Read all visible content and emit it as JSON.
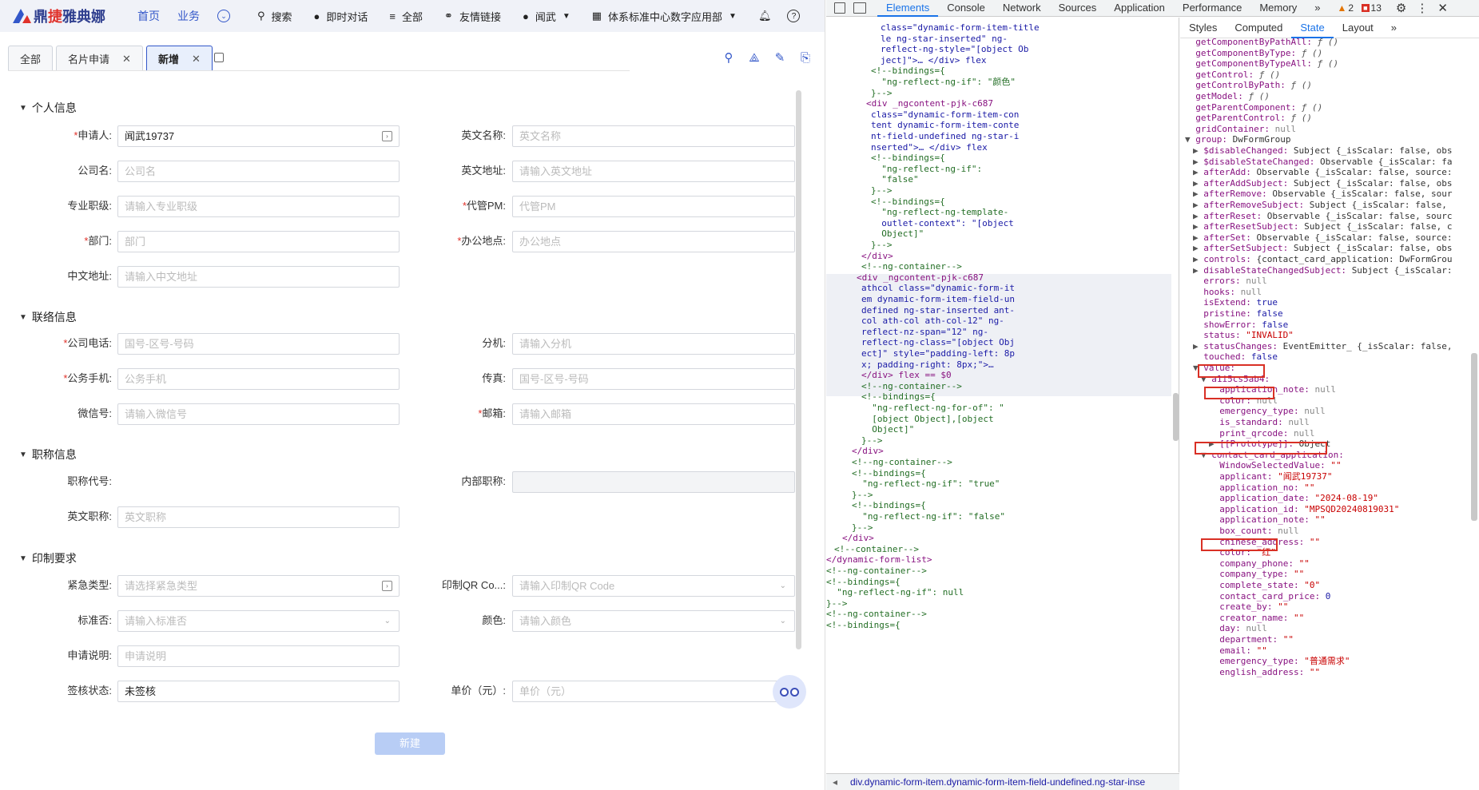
{
  "app": {
    "logo_text_a": "鼎",
    "logo_text_b": "捷",
    "logo_text_c": "雅典娜",
    "nav": [
      "首页",
      "业务"
    ],
    "top_items": [
      {
        "icon": "search-icon",
        "label": "搜索"
      },
      {
        "icon": "chat-icon",
        "label": "即时对话"
      },
      {
        "icon": "menu-icon",
        "label": "全部"
      },
      {
        "icon": "link-icon",
        "label": "友情链接"
      },
      {
        "icon": "user-icon",
        "label": "闻武"
      },
      {
        "icon": "building-icon",
        "label": "体系标准中心数字应用部"
      }
    ]
  },
  "tabs": [
    {
      "label": "全部",
      "closable": false,
      "active": false
    },
    {
      "label": "名片申请",
      "closable": true,
      "active": false
    },
    {
      "label": "新增",
      "closable": true,
      "active": true
    }
  ],
  "sections": {
    "personal": "个人信息",
    "contact": "联络信息",
    "title": "职称信息",
    "print": "印制要求"
  },
  "fields": {
    "applicant": {
      "label": "申请人:",
      "required": true,
      "value": "闻武19737",
      "placeholder": ""
    },
    "english_name": {
      "label": "英文名称:",
      "required": false,
      "value": "",
      "placeholder": "英文名称"
    },
    "company_name": {
      "label": "公司名:",
      "required": false,
      "value": "",
      "placeholder": "公司名"
    },
    "english_address": {
      "label": "英文地址:",
      "required": false,
      "value": "",
      "placeholder": "请输入英文地址"
    },
    "professional_rank": {
      "label": "专业职级:",
      "required": false,
      "value": "",
      "placeholder": "请输入专业职级"
    },
    "acting_pm": {
      "label": "代管PM:",
      "required": true,
      "value": "",
      "placeholder": "代管PM"
    },
    "department": {
      "label": "部门:",
      "required": true,
      "value": "",
      "placeholder": "部门"
    },
    "office_location": {
      "label": "办公地点:",
      "required": true,
      "value": "",
      "placeholder": "办公地点"
    },
    "chinese_address": {
      "label": "中文地址:",
      "required": false,
      "value": "",
      "placeholder": "请输入中文地址"
    },
    "company_phone": {
      "label": "公司电话:",
      "required": true,
      "value": "",
      "placeholder": "国号-区号-号码"
    },
    "extension": {
      "label": "分机:",
      "required": false,
      "value": "",
      "placeholder": "请输入分机"
    },
    "business_mobile": {
      "label": "公务手机:",
      "required": true,
      "value": "",
      "placeholder": "公务手机"
    },
    "fax": {
      "label": "传真:",
      "required": false,
      "value": "",
      "placeholder": "国号-区号-号码"
    },
    "wechat": {
      "label": "微信号:",
      "required": false,
      "value": "",
      "placeholder": "请输入微信号"
    },
    "email": {
      "label": "邮箱:",
      "required": true,
      "value": "",
      "placeholder": "请输入邮箱"
    },
    "title_code": {
      "label": "职称代号:",
      "required": false,
      "value": "",
      "placeholder": ""
    },
    "internal_title": {
      "label": "内部职称:",
      "required": false,
      "value": "",
      "placeholder": ""
    },
    "english_title": {
      "label": "英文职称:",
      "required": false,
      "value": "",
      "placeholder": "英文职称"
    },
    "emergency_type": {
      "label": "紧急类型:",
      "required": false,
      "value": "",
      "placeholder": "请选择紧急类型"
    },
    "print_qr": {
      "label": "印制QR Co...:",
      "required": false,
      "value": "",
      "placeholder": "请输入印制QR Code"
    },
    "is_standard": {
      "label": "标准否:",
      "required": false,
      "value": "",
      "placeholder": "请输入标准否"
    },
    "color": {
      "label": "颜色:",
      "required": false,
      "value": "",
      "placeholder": "请输入颜色"
    },
    "application_note": {
      "label": "申请说明:",
      "required": false,
      "value": "",
      "placeholder": "申请说明"
    },
    "review_status": {
      "label": "签核状态:",
      "required": false,
      "value": "未签核",
      "placeholder": ""
    },
    "unit_price": {
      "label": "单价（元）:",
      "required": false,
      "value": "",
      "placeholder": "单价（元）"
    }
  },
  "new_button": "新建",
  "devtools": {
    "tabs": [
      "Elements",
      "Console",
      "Network",
      "Sources",
      "Application",
      "Performance",
      "Memory",
      "»"
    ],
    "active_tab": "Elements",
    "warnings": "2",
    "errors": "13",
    "side_tabs": [
      "Styles",
      "Computed",
      "State",
      "Layout",
      "»"
    ],
    "active_side_tab": "State",
    "breadcrumb": "div.dynamic-form-item.dynamic-form-item-field-undefined.ng-star-inse",
    "element_lines": [
      "class=\"dynamic-form-item-title",
      "le ng-star-inserted\" ng-",
      "reflect-ng-style=\"[object Ob",
      "ject]\">… </div> flex",
      "<!--bindings={",
      "  \"ng-reflect-ng-if\": \"颜色\"",
      "}-->",
      "<div _ngcontent-pjk-c687",
      "class=\"dynamic-form-item-con",
      "tent dynamic-form-item-conte",
      "nt-field-undefined ng-star-i",
      "nserted\">… </div> flex",
      "<!--bindings={",
      "  \"ng-reflect-ng-if\":",
      "  \"false\"",
      "}-->",
      "<!--bindings={",
      "  \"ng-reflect-ng-template-",
      "  outlet-context\": \"[object",
      "  Object]\"",
      "}-->",
      "</div>",
      "<!--ng-container-->",
      "<div _ngcontent-pjk-c687",
      "athcol class=\"dynamic-form-it",
      "em dynamic-form-item-field-un",
      "defined ng-star-inserted ant-",
      "col ath-col ath-col-12\" ng-",
      "reflect-nz-span=\"12\" ng-",
      "reflect-ng-class=\"[object Obj",
      "ect]\" style=\"padding-left: 8p",
      "x; padding-right: 8px;\">…",
      "</div> flex == $0",
      "<!--ng-container-->",
      "<!--bindings={",
      "  \"ng-reflect-ng-for-of\": \"",
      "  [object Object],[object",
      "  Object]\"",
      "}-->",
      "</div>",
      "<!--ng-container-->",
      "<!--bindings={",
      "  \"ng-reflect-ng-if\": \"true\"",
      "}-->",
      "<!--bindings={",
      "  \"ng-reflect-ng-if\": \"false\"",
      "}-->",
      "</div>",
      "<!--container-->",
      "</dynamic-form-list>",
      "<!--ng-container-->",
      "<!--bindings={",
      "  \"ng-reflect-ng-if\": null",
      "}-->",
      "<!--ng-container-->",
      "<!--bindings={"
    ],
    "state_lines": [
      "getComponentByPathAll: ƒ ()",
      "getComponentByType: ƒ ()",
      "getComponentByTypeAll: ƒ ()",
      "getControl: ƒ ()",
      "getControlByPath: ƒ ()",
      "getModel: ƒ ()",
      "getParentComponent: ƒ ()",
      "getParentControl: ƒ ()",
      "gridContainer: null",
      "group: DwFormGroup",
      "$disableChanged: Subject {_isScalar: false, obs",
      "$disableStateChanged: Observable {_isScalar: fa",
      "afterAdd: Observable {_isScalar: false, source:",
      "afterAddSubject: Subject {_isScalar: false, obs",
      "afterRemove: Observable {_isScalar: false, sour",
      "afterRemoveSubject: Subject {_isScalar: false,",
      "afterReset: Observable {_isScalar: false, sourc",
      "afterResetSubject: Subject {_isScalar: false, c",
      "afterSet: Observable {_isScalar: false, source:",
      "afterSetSubject: Subject {_isScalar: false, obs",
      "controls: {contact_card_application: DwFormGrou",
      "disableStateChangedSubject: Subject {_isScalar:",
      "errors: null",
      "hooks: null",
      "isExtend: true",
      "pristine: false",
      "showError: false",
      "status: \"INVALID\"",
      "statusChanges: EventEmitter_ {_isScalar: false,",
      "touched: false",
      "value:",
      "a1i5cs5ab4:",
      "application_note: null",
      "color: null",
      "emergency_type: null",
      "is_standard: null",
      "print_qrcode: null",
      "[[Prototype]]: Object",
      "contact_card_application:",
      "WindowSelectedValue: \"\"",
      "applicant: \"闻武19737\"",
      "application_no: \"\"",
      "application_date: \"2024-08-19\"",
      "application_id: \"MPSQD20240819031\"",
      "application_note: \"\"",
      "box_count: null",
      "chinese_address: \"\"",
      "color: \"红\"",
      "company_phone: \"\"",
      "company_type: \"\"",
      "complete_state: \"0\"",
      "contact_card_price: 0",
      "create_by: \"\"",
      "creator_name: \"\"",
      "day: null",
      "department: \"\"",
      "email: \"\"",
      "emergency_type: \"普通需求\"",
      "english_address: \"\""
    ]
  }
}
